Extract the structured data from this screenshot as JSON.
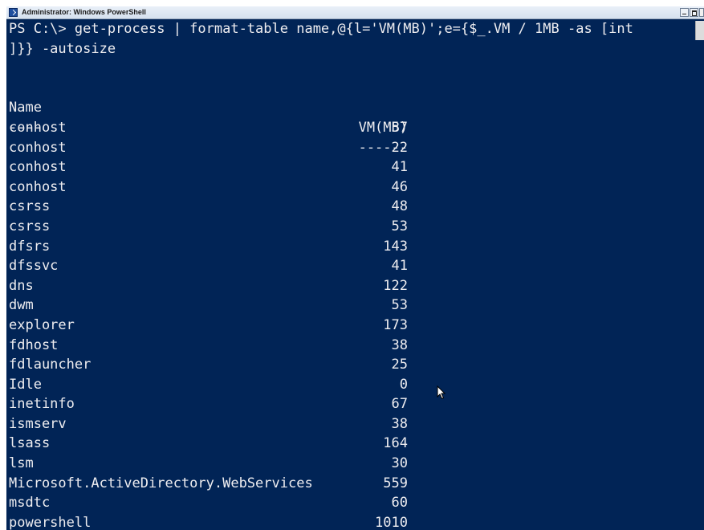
{
  "window": {
    "title": "Administrator: Windows PowerShell"
  },
  "console": {
    "command_line_1": "PS C:\\> get-process | format-table name,@{l='VM(MB)';e={$_.VM / 1MB -as [int",
    "command_line_2": "]}} -autosize",
    "header_name": "Name",
    "header_vm": "VM(MB)",
    "sep_name": "----",
    "sep_vm": "------",
    "rows": [
      {
        "name": "conhost",
        "vm": "57"
      },
      {
        "name": "conhost",
        "vm": "22"
      },
      {
        "name": "conhost",
        "vm": "41"
      },
      {
        "name": "conhost",
        "vm": "46"
      },
      {
        "name": "csrss",
        "vm": "48"
      },
      {
        "name": "csrss",
        "vm": "53"
      },
      {
        "name": "dfsrs",
        "vm": "143"
      },
      {
        "name": "dfssvc",
        "vm": "41"
      },
      {
        "name": "dns",
        "vm": "122"
      },
      {
        "name": "dwm",
        "vm": "53"
      },
      {
        "name": "explorer",
        "vm": "173"
      },
      {
        "name": "fdhost",
        "vm": "38"
      },
      {
        "name": "fdlauncher",
        "vm": "25"
      },
      {
        "name": "Idle",
        "vm": "0"
      },
      {
        "name": "inetinfo",
        "vm": "67"
      },
      {
        "name": "ismserv",
        "vm": "38"
      },
      {
        "name": "lsass",
        "vm": "164"
      },
      {
        "name": "lsm",
        "vm": "30"
      },
      {
        "name": "Microsoft.ActiveDirectory.WebServices",
        "vm": "559"
      },
      {
        "name": "msdtc",
        "vm": "60"
      },
      {
        "name": "powershell",
        "vm": "1010"
      }
    ]
  },
  "colors": {
    "background": "#012456",
    "text": "#eeedf0"
  }
}
